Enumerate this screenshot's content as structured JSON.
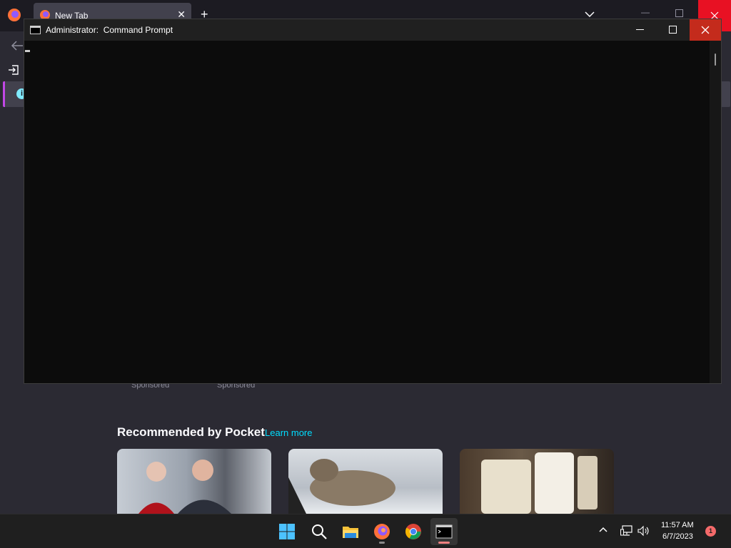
{
  "browser": {
    "tab_title": "New Tab",
    "sponsored_labels": [
      "Sponsored",
      "Sponsored"
    ],
    "pocket": {
      "heading": "Recommended by Pocket",
      "learn_more": "Learn more"
    },
    "accent_color": "#00ddff"
  },
  "terminal": {
    "title": "Administrator:  Command Prompt",
    "content": ""
  },
  "taskbar": {
    "apps": [
      "start-icon",
      "search-icon",
      "file-explorer-icon",
      "firefox-icon",
      "chrome-icon",
      "command-prompt-icon"
    ],
    "clock": {
      "time": "11:57 AM",
      "date": "6/7/2023"
    },
    "notification_count": "1"
  }
}
